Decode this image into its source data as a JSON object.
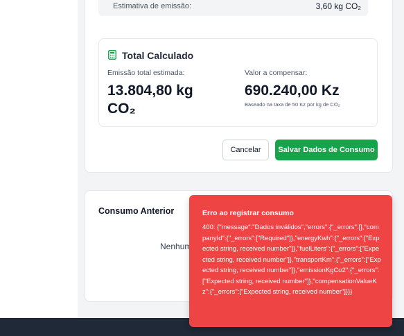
{
  "emission": {
    "label": "Estimativa de emissão:",
    "value": "3,60 kg CO₂"
  },
  "total": {
    "title": "Total Calculado",
    "icon": "calculator-icon",
    "emission_label": "Emissão total estimada:",
    "emission_value": "13.804,80 kg",
    "emission_unit": "CO₂",
    "compensation_label": "Valor a compensar:",
    "compensation_value": "690.240,00 Kz",
    "compensation_note": "Baseado na taxa de 50 Kz por kg de CO₂"
  },
  "actions": {
    "cancel_label": "Cancelar",
    "save_label": "Salvar Dados de Consumo"
  },
  "previous": {
    "title": "Consumo Anterior",
    "empty_text": "Nenhum"
  },
  "toast": {
    "title": "Erro ao registrar consumo",
    "message": "400: {\"message\":\"Dados inválidos\",\"errors\":{\"_errors\":[],\"companyId\":{\"_errors\":[\"Required\"]},\"energyKwh\":{\"_errors\":[\"Expected string, received number\"]},\"fuelLiters\":{\"_errors\":[\"Expected string, received number\"]},\"transportKm\":{\"_errors\":[\"Expected string, received number\"]},\"emissionKgCo2\":{\"_errors\":[\"Expected string, received number\"]},\"compensationValueKz\":{\"_errors\":[\"Expected string, received number\"]}}}"
  },
  "colors": {
    "primary_green": "#16a34a",
    "error_red": "#ef4444",
    "footer_dark": "#1f2937"
  }
}
